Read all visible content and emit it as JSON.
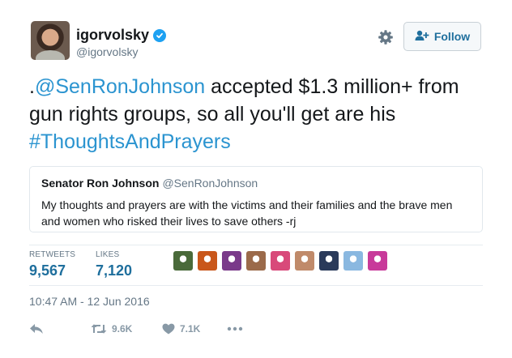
{
  "user": {
    "name": "igorvolsky",
    "handle": "@igorvolsky"
  },
  "header": {
    "follow_label": "Follow"
  },
  "tweet": {
    "text_prefix": ".",
    "mention": "@SenRonJohnson",
    "text_middle": " accepted $1.3 million+ from gun rights groups, so all you'll get are his ",
    "hashtag": "#ThoughtsAndPrayers"
  },
  "quoted": {
    "name": "Senator Ron Johnson",
    "handle": "@SenRonJohnson",
    "text": "My thoughts and prayers are with the victims and their families and the brave men and women who risked their lives to save others -rj"
  },
  "stats": {
    "retweets_label": "RETWEETS",
    "retweets_value": "9,567",
    "likes_label": "LIKES",
    "likes_value": "7,120",
    "liker_colors": [
      "#4a6a3a",
      "#c9571b",
      "#7a3a8a",
      "#9b6a4a",
      "#d84a7a",
      "#c08a6a",
      "#2a3a5a",
      "#8ab8e0",
      "#c83a9a"
    ]
  },
  "timestamp": "10:47 AM - 12 Jun 2016",
  "actions": {
    "retweet_count": "9.6K",
    "like_count": "7.1K"
  },
  "colors": {
    "link": "#2b94d0",
    "brand_blue": "#1da1f2",
    "muted": "#657786"
  }
}
